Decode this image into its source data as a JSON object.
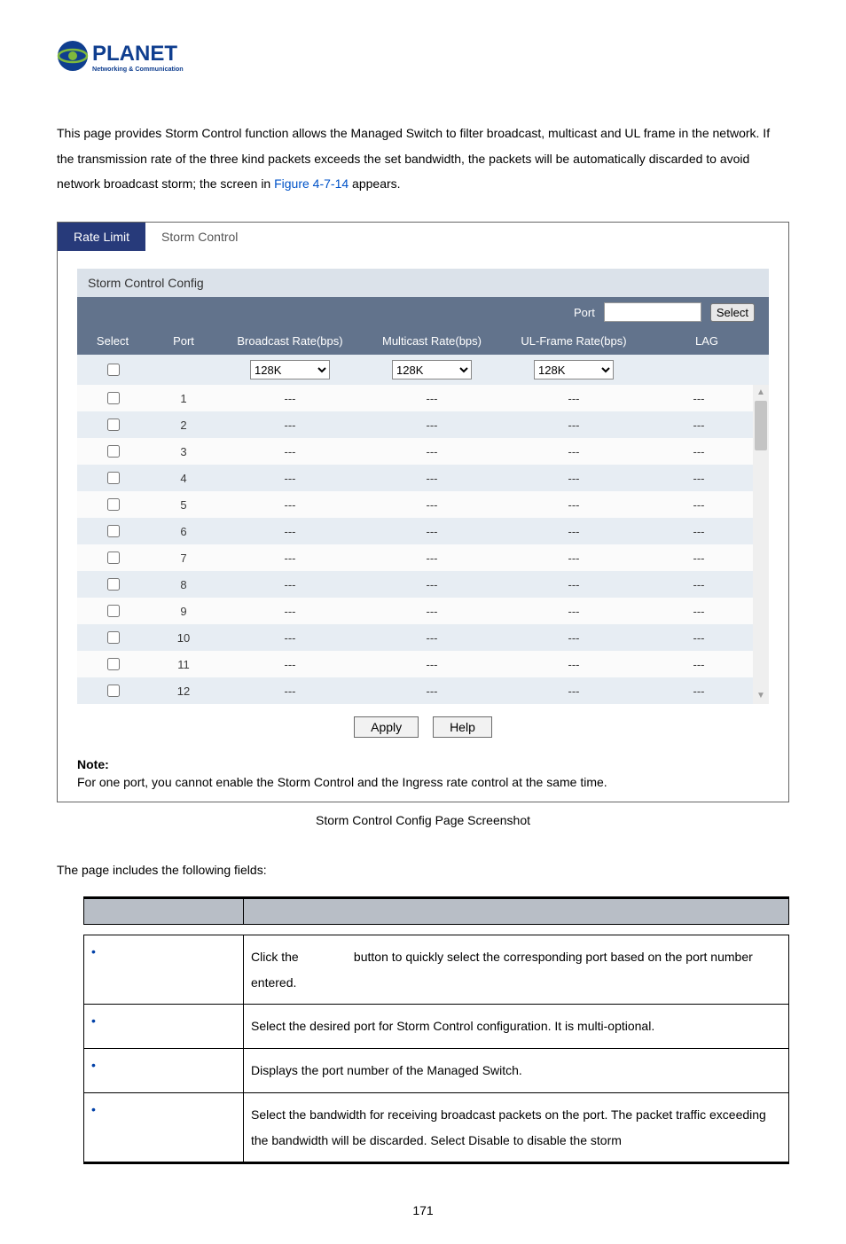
{
  "logo": {
    "brand": "PLANET",
    "tagline": "Networking & Communication"
  },
  "intro": {
    "line1_pre": "This page provides Storm Control function allows the Managed Switch to filter broadcast, multicast and UL frame in the network. If the transmission rate of the three kind packets exceeds the set bandwidth, the packets will be automatically discarded to avoid network broadcast storm; the screen in ",
    "figref": "Figure 4-7-14",
    "line1_post": " appears."
  },
  "screenshot": {
    "tabs": {
      "inactive": "Rate Limit",
      "active": "Storm Control"
    },
    "panel_title": "Storm Control Config",
    "port_bar": {
      "label": "Port",
      "button": "Select"
    },
    "columns": {
      "select": "Select",
      "port": "Port",
      "broadcast": "Broadcast Rate(bps)",
      "multicast": "Multicast Rate(bps)",
      "ulframe": "UL-Frame Rate(bps)",
      "lag": "LAG"
    },
    "dropdown_value": "128K",
    "rows": [
      {
        "port": "1",
        "broadcast": "---",
        "multicast": "---",
        "ulframe": "---",
        "lag": "---"
      },
      {
        "port": "2",
        "broadcast": "---",
        "multicast": "---",
        "ulframe": "---",
        "lag": "---"
      },
      {
        "port": "3",
        "broadcast": "---",
        "multicast": "---",
        "ulframe": "---",
        "lag": "---"
      },
      {
        "port": "4",
        "broadcast": "---",
        "multicast": "---",
        "ulframe": "---",
        "lag": "---"
      },
      {
        "port": "5",
        "broadcast": "---",
        "multicast": "---",
        "ulframe": "---",
        "lag": "---"
      },
      {
        "port": "6",
        "broadcast": "---",
        "multicast": "---",
        "ulframe": "---",
        "lag": "---"
      },
      {
        "port": "7",
        "broadcast": "---",
        "multicast": "---",
        "ulframe": "---",
        "lag": "---"
      },
      {
        "port": "8",
        "broadcast": "---",
        "multicast": "---",
        "ulframe": "---",
        "lag": "---"
      },
      {
        "port": "9",
        "broadcast": "---",
        "multicast": "---",
        "ulframe": "---",
        "lag": "---"
      },
      {
        "port": "10",
        "broadcast": "---",
        "multicast": "---",
        "ulframe": "---",
        "lag": "---"
      },
      {
        "port": "11",
        "broadcast": "---",
        "multicast": "---",
        "ulframe": "---",
        "lag": "---"
      },
      {
        "port": "12",
        "broadcast": "---",
        "multicast": "---",
        "ulframe": "---",
        "lag": "---"
      }
    ],
    "buttons": {
      "apply": "Apply",
      "help": "Help"
    },
    "note_title": "Note:",
    "note_text": "For one port, you cannot enable the Storm Control and the Ingress rate control at the same time."
  },
  "caption": "Storm Control Config Page Screenshot",
  "fields_intro": "The page includes the following fields:",
  "fields_table": {
    "head_obj": "",
    "head_desc": "",
    "rows": [
      {
        "obj": "",
        "desc_pre": "Click the ",
        "desc_mid": "",
        "desc_post": " button to quickly select the corresponding port based on the port number entered."
      },
      {
        "obj": "",
        "desc": "Select the desired port for Storm Control configuration. It is multi-optional."
      },
      {
        "obj": "",
        "desc": "Displays the port number of the Managed Switch."
      },
      {
        "obj": "",
        "desc": "Select the bandwidth for receiving broadcast packets on the port. The packet traffic exceeding the bandwidth will be discarded. Select Disable to disable the storm"
      }
    ]
  },
  "page_number": "171"
}
